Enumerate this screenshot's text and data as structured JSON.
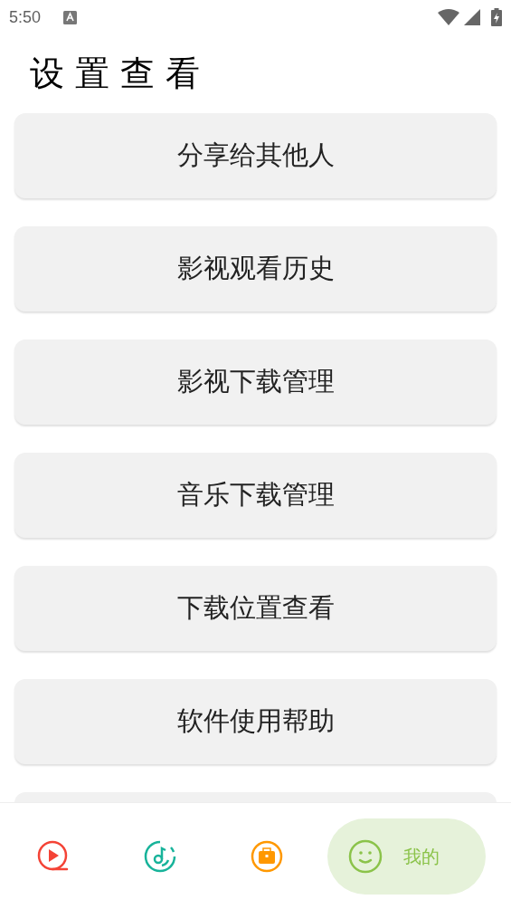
{
  "status_bar": {
    "time": "5:50"
  },
  "title": "设置查看",
  "menu_items": [
    {
      "label": "分享给其他人"
    },
    {
      "label": "影视观看历史"
    },
    {
      "label": "影视下载管理"
    },
    {
      "label": "音乐下载管理"
    },
    {
      "label": "下载位置查看"
    },
    {
      "label": "软件使用帮助"
    }
  ],
  "bottom_nav": [
    {
      "kind": "video",
      "selected": false
    },
    {
      "kind": "music",
      "selected": false
    },
    {
      "kind": "tools",
      "selected": false
    },
    {
      "kind": "mine",
      "selected": true,
      "label": "我的"
    }
  ]
}
